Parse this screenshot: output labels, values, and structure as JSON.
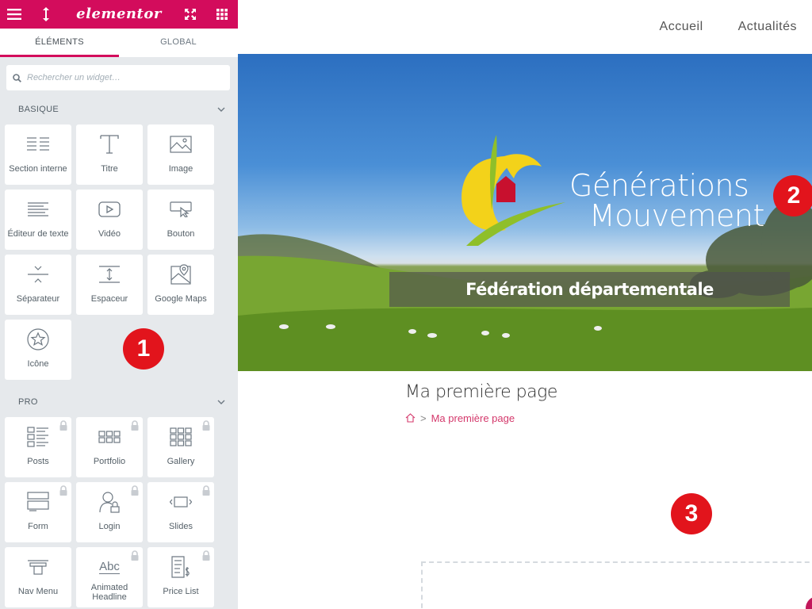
{
  "editor": {
    "brand": "elementor",
    "tabs": [
      {
        "label": "ÉLÉMENTS",
        "active": true
      },
      {
        "label": "GLOBAL",
        "active": false
      }
    ],
    "search": {
      "placeholder": "Rechercher un widget…"
    },
    "categories": [
      {
        "title": "BASIQUE",
        "widgets": [
          {
            "label": "Section interne",
            "icon": "inner-section-icon"
          },
          {
            "label": "Titre",
            "icon": "heading-icon"
          },
          {
            "label": "Image",
            "icon": "image-icon"
          },
          {
            "label": "Éditeur de texte",
            "icon": "text-editor-icon"
          },
          {
            "label": "Vidéo",
            "icon": "video-icon"
          },
          {
            "label": "Bouton",
            "icon": "button-icon"
          },
          {
            "label": "Séparateur",
            "icon": "divider-icon"
          },
          {
            "label": "Espaceur",
            "icon": "spacer-icon"
          },
          {
            "label": "Google Maps",
            "icon": "map-icon"
          },
          {
            "label": "Icône",
            "icon": "star-icon"
          }
        ]
      },
      {
        "title": "PRO",
        "widgets": [
          {
            "label": "Posts",
            "icon": "posts-icon",
            "locked": true
          },
          {
            "label": "Portfolio",
            "icon": "portfolio-icon",
            "locked": true
          },
          {
            "label": "Gallery",
            "icon": "gallery-icon",
            "locked": true
          },
          {
            "label": "Form",
            "icon": "form-icon",
            "locked": true
          },
          {
            "label": "Login",
            "icon": "login-icon",
            "locked": true
          },
          {
            "label": "Slides",
            "icon": "slides-icon",
            "locked": true
          },
          {
            "label": "Nav Menu",
            "icon": "nav-menu-icon",
            "locked": true
          },
          {
            "label": "Animated Headline",
            "icon": "animated-headline-icon",
            "locked": true,
            "icon_text": "Abc"
          },
          {
            "label": "Price List",
            "icon": "price-list-icon",
            "locked": true
          }
        ]
      }
    ],
    "accent": "#d30c5c"
  },
  "site": {
    "nav": [
      "Accueil",
      "Actualités"
    ],
    "hero": {
      "logo_line1": "Générations",
      "logo_line2": "Mouvement",
      "title": "Fédération départementale"
    },
    "page_title": "Ma première page",
    "breadcrumb": {
      "current": "Ma première page"
    }
  },
  "callouts": [
    "1",
    "2",
    "3"
  ]
}
